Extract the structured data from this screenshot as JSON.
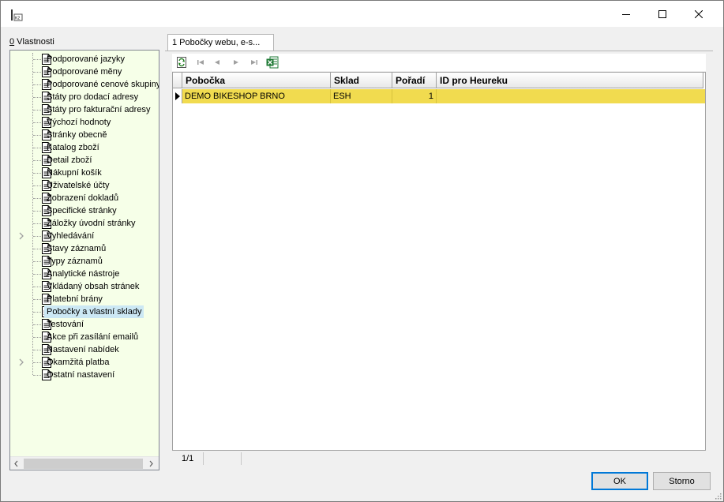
{
  "window": {
    "title": "",
    "app_icon_text": "K2",
    "controls": {
      "minimize": "minimize",
      "maximize": "maximize",
      "close": "close"
    }
  },
  "properties": {
    "label_accel": "0",
    "label_rest": " Vlastnosti"
  },
  "tree": {
    "items": [
      {
        "label": "Podporované jazyky",
        "expandable": false
      },
      {
        "label": "Podporované měny",
        "expandable": false
      },
      {
        "label": "Podporované cenové skupiny",
        "expandable": false
      },
      {
        "label": "Státy pro dodací adresy",
        "expandable": false
      },
      {
        "label": "Státy pro fakturační adresy",
        "expandable": false
      },
      {
        "label": "Výchozí hodnoty",
        "expandable": false
      },
      {
        "label": "Stránky obecně",
        "expandable": false
      },
      {
        "label": "Katalog zboží",
        "expandable": false
      },
      {
        "label": "Detail zboží",
        "expandable": false
      },
      {
        "label": "Nákupní košík",
        "expandable": false
      },
      {
        "label": "Uživatelské účty",
        "expandable": false
      },
      {
        "label": "Zobrazení dokladů",
        "expandable": false
      },
      {
        "label": "Specifické stránky",
        "expandable": false
      },
      {
        "label": "Záložky úvodní stránky",
        "expandable": false
      },
      {
        "label": "Vyhledávání",
        "expandable": true
      },
      {
        "label": "Stavy záznamů",
        "expandable": false
      },
      {
        "label": "Typy záznamů",
        "expandable": false
      },
      {
        "label": "Analytické nástroje",
        "expandable": false
      },
      {
        "label": "Vkládaný obsah stránek",
        "expandable": false
      },
      {
        "label": "Platební brány",
        "expandable": false
      },
      {
        "label": "Pobočky a vlastní sklady",
        "expandable": false,
        "selected": true
      },
      {
        "label": "Testování",
        "expandable": false
      },
      {
        "label": "Akce při zasílání emailů",
        "expandable": false
      },
      {
        "label": "Nastavení nabídek",
        "expandable": false
      },
      {
        "label": "Okamžitá platba",
        "expandable": true
      },
      {
        "label": "Ostatní nastavení",
        "expandable": false
      }
    ]
  },
  "tab": {
    "label": "1 Pobočky webu, e-s..."
  },
  "toolbar": {
    "buttons": [
      "refresh-icon",
      "first-record-icon",
      "previous-record-icon",
      "next-record-icon",
      "last-record-icon",
      "excel-export-icon"
    ]
  },
  "grid": {
    "columns": [
      "Pobočka",
      "Sklad",
      "Pořadí",
      "ID pro Heureku"
    ],
    "rows": [
      {
        "pobocka": "DEMO BIKESHOP BRNO",
        "sklad": "ESH",
        "poradi": "1",
        "heureka": ""
      }
    ]
  },
  "status": {
    "record_position": "1/1"
  },
  "buttons": {
    "ok": "OK",
    "cancel": "Storno"
  },
  "colors": {
    "tree_bg": "#f6ffe8",
    "row_highlight": "#f1db4f",
    "selected_item": "#cce8f4",
    "ok_border": "#0078d7"
  }
}
